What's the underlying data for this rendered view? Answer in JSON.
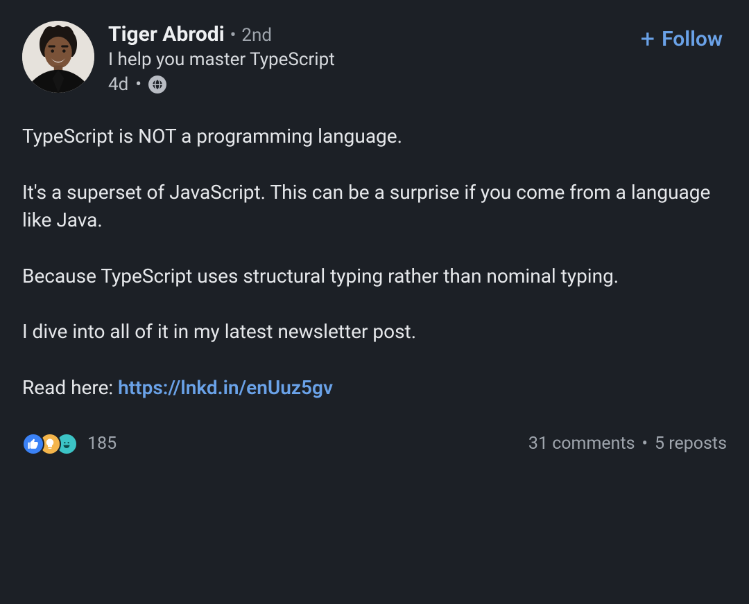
{
  "post": {
    "author": {
      "name": "Tiger Abrodi",
      "degree": "2nd",
      "headline": "I help you master TypeScript",
      "time": "4d"
    },
    "follow_label": "Follow",
    "body": {
      "p1": "TypeScript is NOT a programming language.",
      "p2": "It's a superset of JavaScript. This can be a surprise if you come from a language like Java.",
      "p3": "Because TypeScript uses structural typing rather than nominal typing.",
      "p4": "I dive into all of it in my latest newsletter post.",
      "p5_prefix": "Read here: ",
      "p5_link": "https://lnkd.in/enUuz5gv"
    },
    "social": {
      "reactions_count": "185",
      "comments": "31 comments",
      "reposts": "5 reposts"
    }
  }
}
